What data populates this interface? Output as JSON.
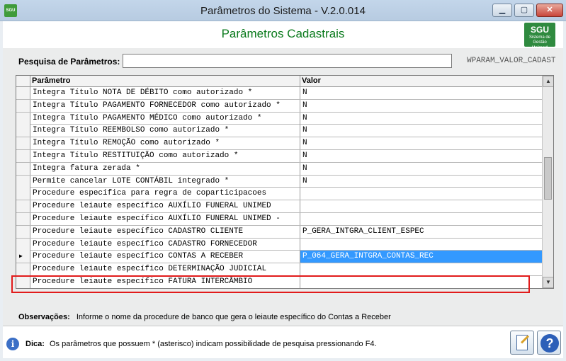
{
  "app_icon": "SGU",
  "window": {
    "title": "Parâmetros do Sistema - V.2.0.014",
    "min_icon": "minimize-icon",
    "max_icon": "maximize-icon",
    "close_icon": "close-icon"
  },
  "header": {
    "title": "Parâmetros Cadastrais",
    "logo_main": "SGU",
    "logo_sub": "Sistema de Gestão",
    "logo_brand": "Unimed"
  },
  "search": {
    "label": "Pesquisa de Parâmetros:",
    "value": "",
    "field_code": "WPARAM_VALOR_CADAST"
  },
  "grid": {
    "columns": {
      "param": "Parâmetro",
      "value": "Valor"
    },
    "current_row_marker": "▶",
    "rows": [
      {
        "param": "Integra Título NOTA DE DÉBITO como autorizado *",
        "value": "N"
      },
      {
        "param": "Integra Título PAGAMENTO FORNECEDOR como autorizado *",
        "value": "N"
      },
      {
        "param": "Integra Título PAGAMENTO MÉDICO como autorizado *",
        "value": "N"
      },
      {
        "param": "Integra Título REEMBOLSO como autorizado *",
        "value": "N"
      },
      {
        "param": "Integra Título REMOÇÃO como autorizado *",
        "value": "N"
      },
      {
        "param": "Integra Título RESTITUIÇÃO como autorizado *",
        "value": "N"
      },
      {
        "param": "Integra fatura zerada *",
        "value": "N"
      },
      {
        "param": "Permite cancelar LOTE CONTÁBIL integrado *",
        "value": "N"
      },
      {
        "param": "Procedure específica para regra de coparticipacoes",
        "value": ""
      },
      {
        "param": "Procedure leiaute específico AUXÍLIO FUNERAL UNIMED",
        "value": ""
      },
      {
        "param": "Procedure leiaute específico AUXÍLIO FUNERAL UNIMED -",
        "value": ""
      },
      {
        "param": "Procedure leiaute específico CADASTRO CLIENTE",
        "value": "P_GERA_INTGRA_CLIENT_ESPEC"
      },
      {
        "param": "Procedure leiaute específico CADASTRO FORNECEDOR",
        "value": ""
      },
      {
        "param": "Procedure leiaute específico CONTAS A RECEBER",
        "value": "P_064_GERA_INTGRA_CONTAS_REC"
      },
      {
        "param": "Procedure leiaute específico DETERMINAÇÃO JUDICIAL",
        "value": ""
      },
      {
        "param": "Procedure leiaute específico FATURA INTERCÂMBIO",
        "value": ""
      }
    ]
  },
  "observacoes": {
    "label": "Observações:",
    "text": "Informe o nome da procedure de banco que gera o leiaute específico do Contas a Receber"
  },
  "footer": {
    "tip_label": "Dica:",
    "tip_text": "Os parâmetros que possuem * (asterisco) indicam possibilidade de pesquisa pressionando F4.",
    "help_label": "?"
  }
}
